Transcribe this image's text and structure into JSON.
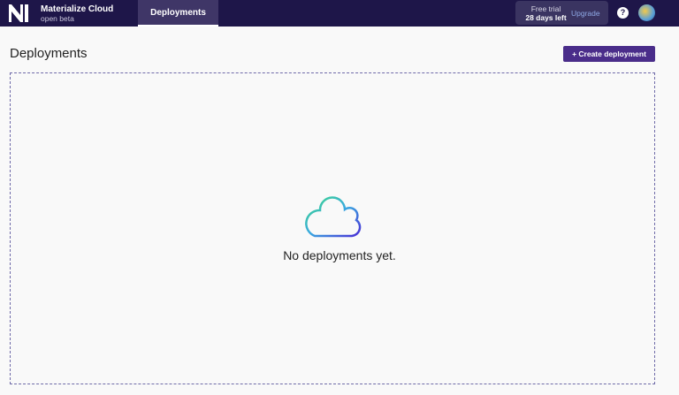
{
  "nav": {
    "brand": "Materialize Cloud",
    "brand_sub": "open beta",
    "tab": "Deployments",
    "trial_label": "Free trial",
    "trial_days": "28 days left",
    "upgrade": "Upgrade",
    "help": "?"
  },
  "main": {
    "title": "Deployments",
    "create_label": "Create deployment",
    "empty_message": "No deployments yet."
  }
}
